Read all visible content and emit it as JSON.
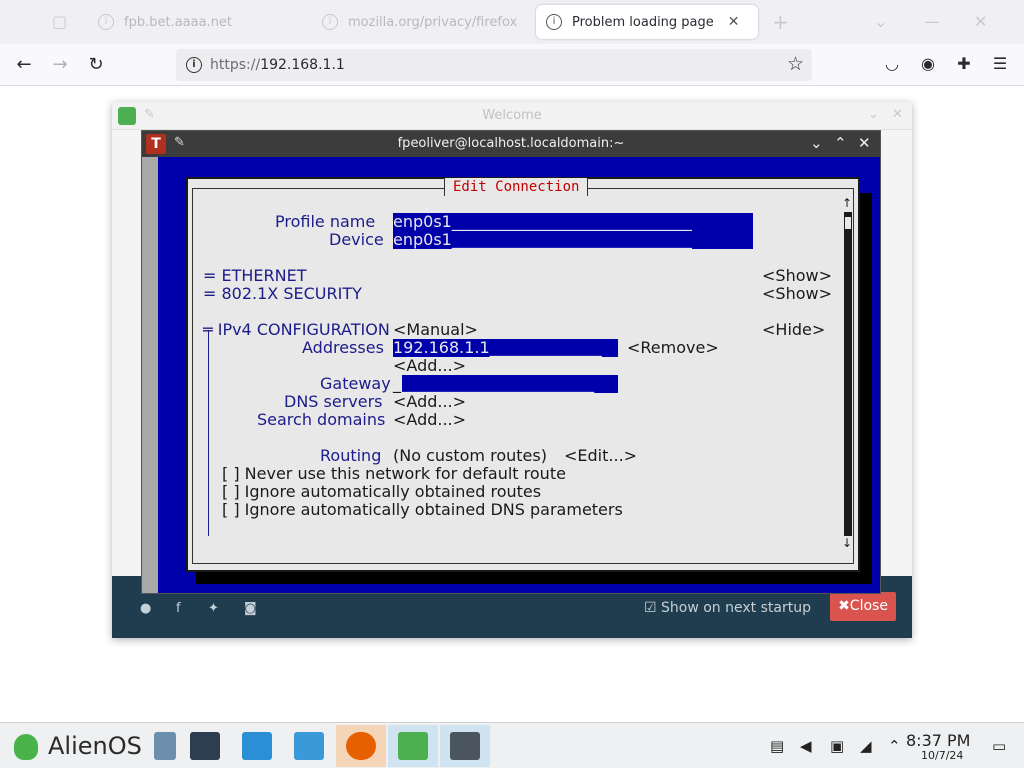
{
  "browser": {
    "tabs": [
      {
        "label": "fpb.bet.aaaa.net",
        "active": false
      },
      {
        "label": "mozilla.org/privacy/firefox",
        "active": false
      },
      {
        "label": "Problem loading page",
        "active": true
      }
    ],
    "new_tab": "+",
    "tab_close": "✕",
    "url_proto": "https://",
    "url_host": "192.168.1.1",
    "icons": [
      "back-arrow-icon",
      "forward-arrow-icon",
      "reload-icon",
      "bookmark-star-icon",
      "pocket-icon",
      "account-icon",
      "extensions-icon",
      "menu-icon"
    ]
  },
  "welcome": {
    "title": "Welcome",
    "show_on_startup": "Show on next startup",
    "close": "Close"
  },
  "terminal": {
    "title": "fpeoliver@localhost.localdomain:~",
    "dialog_title": "Edit Connection",
    "profile_label": "Profile name",
    "profile_value": "enp0s1",
    "device_label": "Device",
    "device_value": "enp0s1",
    "ethernet": "= ETHERNET",
    "security": "= 802.1X SECURITY",
    "show": "<Show>",
    "ipv4": "═ IPv4 CONFIGURATION",
    "ipv4_mode": "<Manual>",
    "hide": "<Hide>",
    "addresses_label": "Addresses",
    "addresses_value": "192.168.1.1",
    "remove": "<Remove>",
    "add": "<Add...>",
    "gateway_label": "Gateway",
    "dns_label": "DNS servers",
    "search_label": "Search domains",
    "routing_label": "Routing",
    "routing_value": "(No custom routes)",
    "edit": "<Edit...>",
    "check1": "[ ] Never use this network for default route",
    "check2": "[ ] Ignore automatically obtained routes",
    "check3": "[ ] Ignore automatically obtained DNS parameters",
    "scroll_up": "↑",
    "scroll_down": "↓"
  },
  "taskbar": {
    "start_label": "AlienOS",
    "time": "8:37 PM",
    "date": "10/7/24"
  },
  "colors": {
    "tui_blue": "#0000aa",
    "tui_bg": "#e8e8e8",
    "tui_title_red": "#c00000",
    "close_red": "#d9534f"
  }
}
